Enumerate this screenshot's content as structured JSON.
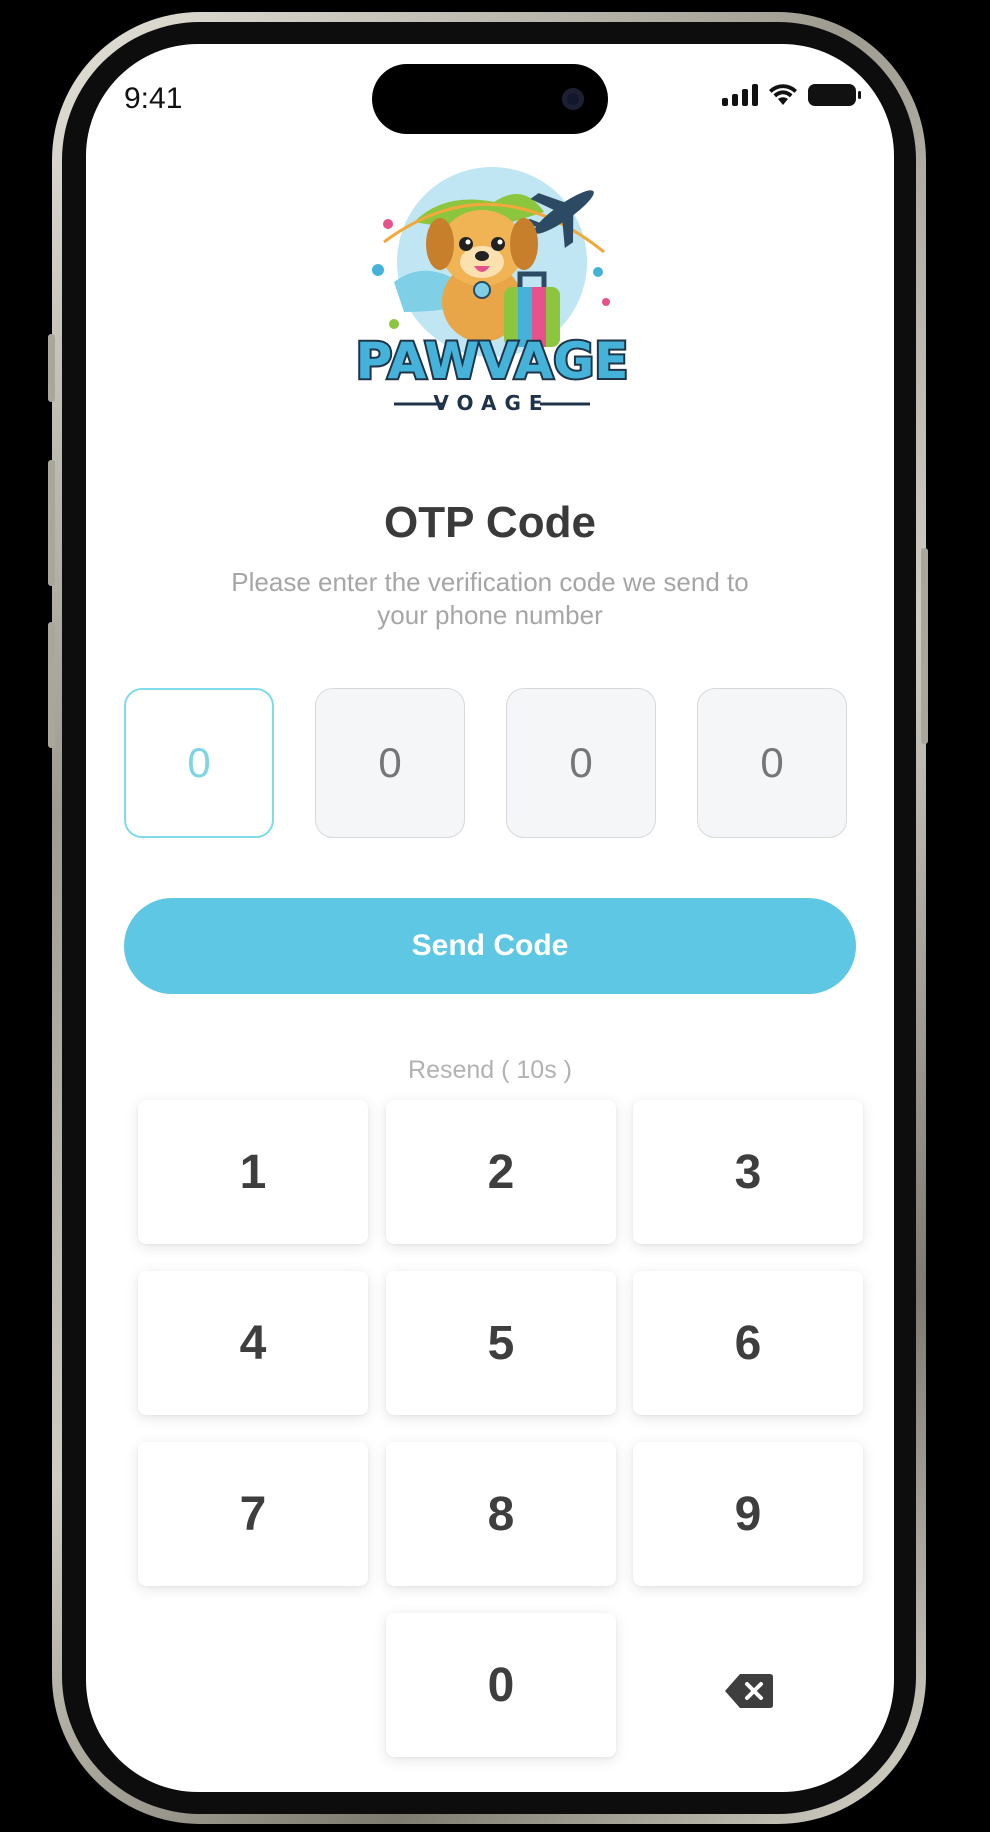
{
  "status_bar": {
    "time": "9:41"
  },
  "logo": {
    "brand": "PAWVAGE",
    "tagline": "VOAGE"
  },
  "otp": {
    "title": "OTP Code",
    "subtitle_line1": "Please enter the verification code we send to",
    "subtitle_line2": "your phone number",
    "digits": [
      "0",
      "0",
      "0",
      "0"
    ]
  },
  "send_button": {
    "label": "Send Code"
  },
  "resend": {
    "label": "Resend ( 10s )"
  },
  "keypad": {
    "keys": [
      "1",
      "2",
      "3",
      "4",
      "5",
      "6",
      "7",
      "8",
      "9",
      "0"
    ],
    "delete_icon": "backspace-icon"
  },
  "colors": {
    "accent": "#5ec7e4",
    "active_border": "#7fdbe7",
    "title": "#3a3a3a",
    "muted": "#a6a6a6"
  }
}
